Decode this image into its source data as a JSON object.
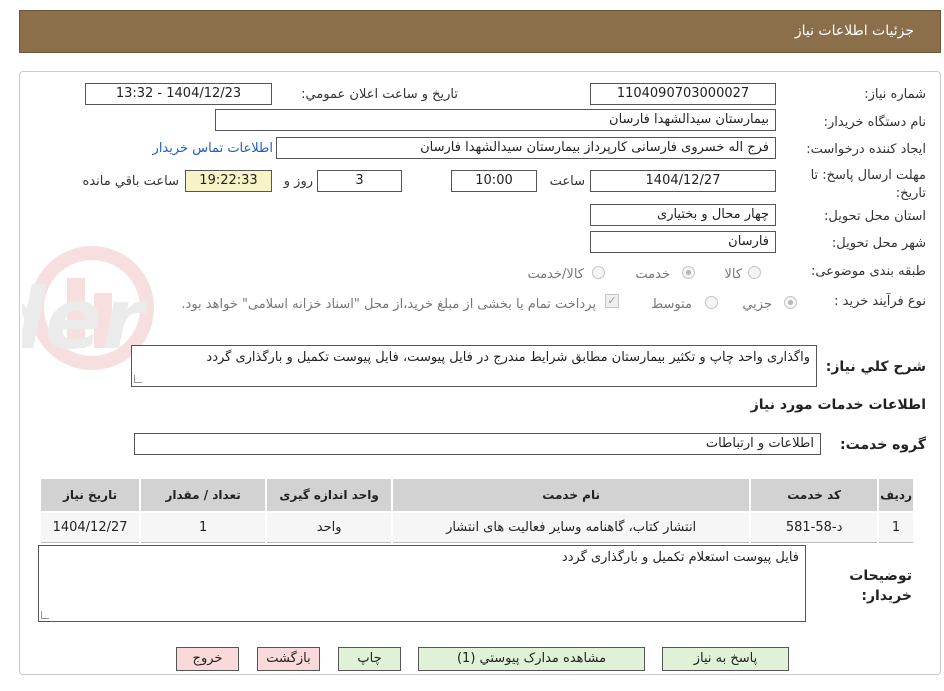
{
  "header": {
    "title": "جزئيات اطلاعات نياز"
  },
  "form": {
    "need_number_label": "شماره نياز:",
    "need_number": "1104090703000027",
    "announce_label": "تاريخ و ساعت اعلان عمومي:",
    "announce_value": "1404/12/23 - 13:32",
    "buyer_org_label": "نام دستگاه خريدار:",
    "buyer_org": "بیمارستان سیدالشهدا فارسان",
    "requester_label": "ايجاد كننده درخواست:",
    "requester": "فرج اله خسروی فارسانی کارپرداز بیمارستان سیدالشهدا فارسان",
    "contact_link": "اطلاعات تماس خريدار",
    "deadline_label": "مهلت ارسال پاسخ: تا تاريخ:",
    "deadline_date": "1404/12/27",
    "hour_label": "ساعت",
    "deadline_time": "10:00",
    "days": "3",
    "days_label": "روز و",
    "remaining_time": "19:22:33",
    "remaining_label": "ساعت باقي مانده",
    "province_label": "استان محل تحويل:",
    "province": "چهار محال و بختیاری",
    "city_label": "شهر محل تحويل:",
    "city": "فارسان",
    "category_label": "طبقه بندی موضوعی:",
    "category_options": [
      "كالا",
      "خدمت",
      "كالا/خدمت"
    ],
    "process_label": "نوع فرآيند خريد :",
    "process_options": [
      "جزيي",
      "متوسط"
    ],
    "payment_note": "پرداخت تمام یا بخشی از مبلغ خرید،از محل \"اسناد خزانه اسلامی\" خواهد بود."
  },
  "description": {
    "label": "شرح كلي نياز:",
    "text": "واگذاری واحد چاپ و تکثیر بیمارستان مطابق شرایط مندرج در فایل پیوست، فایل پیوست تکمیل و بارگذاری گردد"
  },
  "services": {
    "section_title": "اطلاعات خدمات مورد نياز",
    "group_label": "گروه خدمت:",
    "group_value": "اطلاعات و ارتباطات",
    "columns": [
      "رديف",
      "كد خدمت",
      "نام خدمت",
      "واحد اندازه گيری",
      "تعداد / مقدار",
      "تاريخ نياز"
    ],
    "rows": [
      [
        "1",
        "د-58-581",
        "انتشار کتاب، گاهنامه وسایر فعالیت های انتشار",
        "واحد",
        "1",
        "1404/12/27"
      ]
    ]
  },
  "buyer_notes": {
    "label": "توضيحات خريدار:",
    "text": "فایل پیوست استعلام تکمیل و بارگذاری گردد"
  },
  "buttons": {
    "reply": "پاسخ به نياز",
    "attachments": "مشاهده مدارک پيوستي (1)",
    "print": "چاپ",
    "back": "بازگشت",
    "exit": "خروج"
  },
  "colors": {
    "header_bg": "#8b6e4a",
    "button_green": "#dff2d8",
    "button_pink": "#f9d9d9",
    "remaining_bg": "#f6f3c6"
  }
}
